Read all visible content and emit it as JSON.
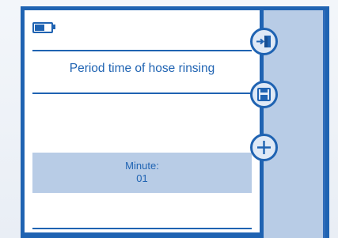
{
  "status": {
    "battery_level": 0.6
  },
  "screen": {
    "title": "Period time of hose rinsing",
    "value_label": "Minute:",
    "value": "01"
  },
  "sidebar": {
    "buttons": [
      {
        "icon": "exit-icon"
      },
      {
        "icon": "save-icon"
      },
      {
        "icon": "plus-icon"
      }
    ]
  },
  "colors": {
    "accent": "#1f63b2",
    "panel": "#b8cce6",
    "screen_bg": "#ffffff"
  }
}
